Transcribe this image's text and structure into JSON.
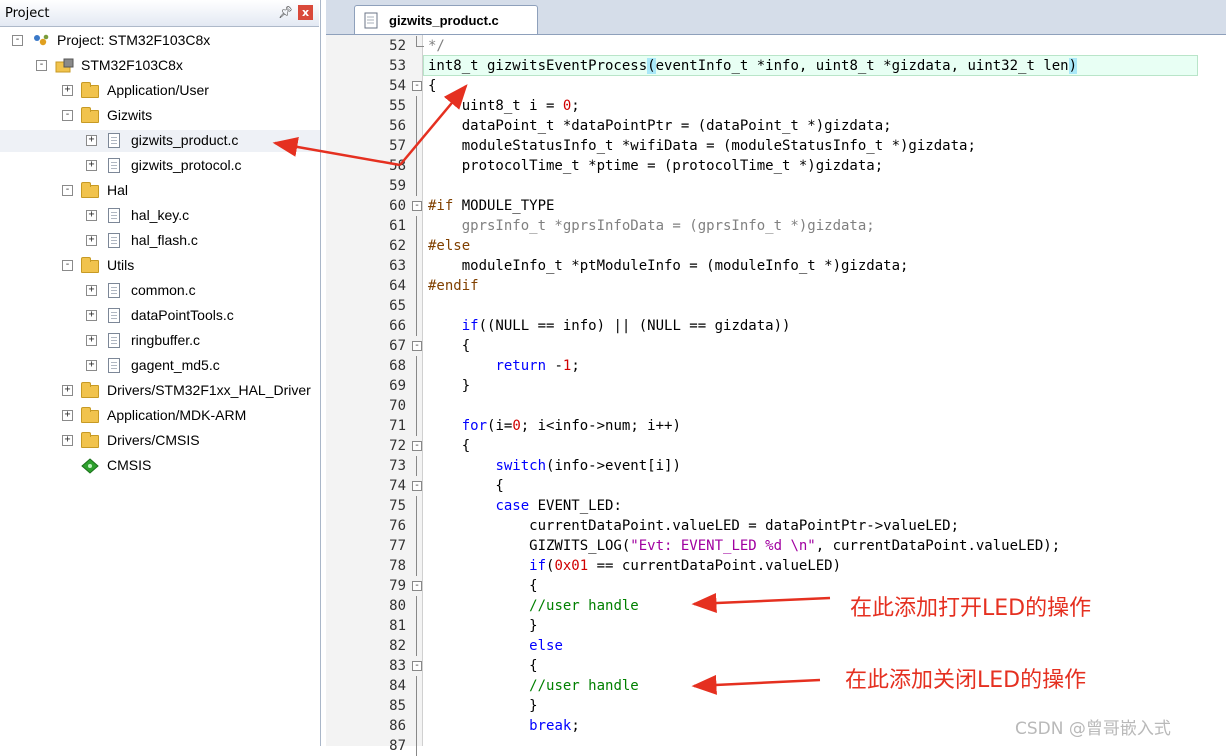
{
  "project_panel": {
    "title": "Project",
    "pin_glyph": "ᴾ",
    "close_glyph": "x",
    "tree": [
      {
        "label": "Project: STM32F103C8x",
        "icon": "project-icon",
        "indent": 0,
        "expander": "-"
      },
      {
        "label": "STM32F103C8x",
        "icon": "target-icon",
        "indent": 1,
        "expander": "-"
      },
      {
        "label": "Application/User",
        "icon": "folder-icon",
        "indent": 2,
        "expander": "+"
      },
      {
        "label": "Gizwits",
        "icon": "folder-icon",
        "indent": 2,
        "expander": "-"
      },
      {
        "label": "gizwits_product.c",
        "icon": "file-icon",
        "indent": 3,
        "expander": "+",
        "selected": true
      },
      {
        "label": "gizwits_protocol.c",
        "icon": "file-icon",
        "indent": 3,
        "expander": "+"
      },
      {
        "label": "Hal",
        "icon": "folder-icon",
        "indent": 2,
        "expander": "-"
      },
      {
        "label": "hal_key.c",
        "icon": "file-icon",
        "indent": 3,
        "expander": "+"
      },
      {
        "label": "hal_flash.c",
        "icon": "file-icon",
        "indent": 3,
        "expander": "+"
      },
      {
        "label": "Utils",
        "icon": "folder-icon",
        "indent": 2,
        "expander": "-"
      },
      {
        "label": "common.c",
        "icon": "file-icon",
        "indent": 3,
        "expander": "+"
      },
      {
        "label": "dataPointTools.c",
        "icon": "file-icon",
        "indent": 3,
        "expander": "+"
      },
      {
        "label": "ringbuffer.c",
        "icon": "file-icon",
        "indent": 3,
        "expander": "+"
      },
      {
        "label": "gagent_md5.c",
        "icon": "file-icon",
        "indent": 3,
        "expander": "+"
      },
      {
        "label": "Drivers/STM32F1xx_HAL_Driver",
        "icon": "folder-icon",
        "indent": 2,
        "expander": "+"
      },
      {
        "label": "Application/MDK-ARM",
        "icon": "folder-icon",
        "indent": 2,
        "expander": "+"
      },
      {
        "label": "Drivers/CMSIS",
        "icon": "folder-icon",
        "indent": 2,
        "expander": "+"
      },
      {
        "label": "CMSIS",
        "icon": "component-icon",
        "indent": 2,
        "expander": ""
      }
    ]
  },
  "editor": {
    "tab_label": "gizwits_product.c",
    "lines": [
      {
        "n": "52",
        "fold": "end",
        "segs": [
          [
            "pp",
            "*/"
          ]
        ]
      },
      {
        "n": "53",
        "fold": "",
        "segs": [
          [
            "",
            "int8_t gizwitsEventProcess"
          ],
          [
            "bm",
            "("
          ],
          [
            "",
            "eventInfo_t *info, uint8_t *gizdata, uint32_t len"
          ],
          [
            "bm",
            ")"
          ]
        ]
      },
      {
        "n": "54",
        "fold": "box",
        "segs": [
          [
            "",
            "{"
          ]
        ]
      },
      {
        "n": "55",
        "fold": "line",
        "segs": [
          [
            "",
            "    uint8_t i = "
          ],
          [
            "num",
            "0"
          ],
          [
            "",
            ";"
          ]
        ]
      },
      {
        "n": "56",
        "fold": "line",
        "segs": [
          [
            "",
            "    dataPoint_t *dataPointPtr = (dataPoint_t *)gizdata;"
          ]
        ]
      },
      {
        "n": "57",
        "fold": "line",
        "segs": [
          [
            "",
            "    moduleStatusInfo_t *wifiData = (moduleStatusInfo_t *)gizdata;"
          ]
        ]
      },
      {
        "n": "58",
        "fold": "line",
        "segs": [
          [
            "",
            "    protocolTime_t *ptime = (protocolTime_t *)gizdata;"
          ]
        ]
      },
      {
        "n": "59",
        "fold": "line",
        "segs": [
          [
            "",
            ""
          ]
        ]
      },
      {
        "n": "60",
        "fold": "box",
        "segs": [
          [
            "pp2",
            "#if"
          ],
          [
            "",
            " MODULE_TYPE"
          ]
        ]
      },
      {
        "n": "61",
        "fold": "line",
        "segs": [
          [
            "pp",
            "    gprsInfo_t *gprsInfoData = (gprsInfo_t *)gizdata;"
          ]
        ]
      },
      {
        "n": "62",
        "fold": "line",
        "segs": [
          [
            "pp2",
            "#else"
          ]
        ]
      },
      {
        "n": "63",
        "fold": "line",
        "segs": [
          [
            "",
            "    moduleInfo_t *ptModuleInfo = (moduleInfo_t *)gizdata;"
          ]
        ]
      },
      {
        "n": "64",
        "fold": "line",
        "segs": [
          [
            "pp2",
            "#endif"
          ]
        ]
      },
      {
        "n": "65",
        "fold": "line",
        "segs": [
          [
            "",
            ""
          ]
        ]
      },
      {
        "n": "66",
        "fold": "line",
        "segs": [
          [
            "",
            "    "
          ],
          [
            "kw",
            "if"
          ],
          [
            "",
            "((NULL == info) || (NULL == gizdata))"
          ]
        ]
      },
      {
        "n": "67",
        "fold": "box",
        "segs": [
          [
            "",
            "    {"
          ]
        ]
      },
      {
        "n": "68",
        "fold": "line",
        "segs": [
          [
            "",
            "        "
          ],
          [
            "kw",
            "return"
          ],
          [
            "",
            " -"
          ],
          [
            "num",
            "1"
          ],
          [
            "",
            ";"
          ]
        ]
      },
      {
        "n": "69",
        "fold": "line",
        "segs": [
          [
            "",
            "    }"
          ]
        ]
      },
      {
        "n": "70",
        "fold": "line",
        "segs": [
          [
            "",
            ""
          ]
        ]
      },
      {
        "n": "71",
        "fold": "line",
        "segs": [
          [
            "",
            "    "
          ],
          [
            "kw",
            "for"
          ],
          [
            "",
            "(i="
          ],
          [
            "num",
            "0"
          ],
          [
            "",
            "; i<info->num; i++)"
          ]
        ]
      },
      {
        "n": "72",
        "fold": "box",
        "segs": [
          [
            "",
            "    {"
          ]
        ]
      },
      {
        "n": "73",
        "fold": "line",
        "segs": [
          [
            "",
            "        "
          ],
          [
            "kw",
            "switch"
          ],
          [
            "",
            "(info->event[i])"
          ]
        ]
      },
      {
        "n": "74",
        "fold": "box",
        "segs": [
          [
            "",
            "        {"
          ]
        ]
      },
      {
        "n": "75",
        "fold": "line",
        "segs": [
          [
            "",
            "        "
          ],
          [
            "kw",
            "case"
          ],
          [
            "",
            " EVENT_LED:"
          ]
        ]
      },
      {
        "n": "76",
        "fold": "line",
        "segs": [
          [
            "",
            "            currentDataPoint.valueLED = dataPointPtr->valueLED;"
          ]
        ]
      },
      {
        "n": "77",
        "fold": "line",
        "segs": [
          [
            "",
            "            GIZWITS_LOG("
          ],
          [
            "str",
            "\"Evt: EVENT_LED %d \\n\""
          ],
          [
            "",
            ", currentDataPoint.valueLED);"
          ]
        ]
      },
      {
        "n": "78",
        "fold": "line",
        "segs": [
          [
            "",
            "            "
          ],
          [
            "kw",
            "if"
          ],
          [
            "",
            "("
          ],
          [
            "num",
            "0x01"
          ],
          [
            "",
            " == currentDataPoint.valueLED)"
          ]
        ]
      },
      {
        "n": "79",
        "fold": "box",
        "segs": [
          [
            "",
            "            {"
          ]
        ]
      },
      {
        "n": "80",
        "fold": "line",
        "segs": [
          [
            "",
            "            "
          ],
          [
            "cm",
            "//user handle"
          ]
        ]
      },
      {
        "n": "81",
        "fold": "line",
        "segs": [
          [
            "",
            "            }"
          ]
        ]
      },
      {
        "n": "82",
        "fold": "line",
        "segs": [
          [
            "",
            "            "
          ],
          [
            "kw",
            "else"
          ]
        ]
      },
      {
        "n": "83",
        "fold": "box",
        "segs": [
          [
            "",
            "            {"
          ]
        ]
      },
      {
        "n": "84",
        "fold": "line",
        "segs": [
          [
            "",
            "            "
          ],
          [
            "cm",
            "//user handle"
          ]
        ]
      },
      {
        "n": "85",
        "fold": "line",
        "segs": [
          [
            "",
            "            }"
          ]
        ]
      },
      {
        "n": "86",
        "fold": "line",
        "segs": [
          [
            "",
            "            "
          ],
          [
            "kw",
            "break"
          ],
          [
            "",
            ";"
          ]
        ]
      },
      {
        "n": "87",
        "fold": "line",
        "segs": [
          [
            "",
            ""
          ]
        ]
      }
    ]
  },
  "annotations": {
    "open_led": "在此添加打开LED的操作",
    "close_led": "在此添加关闭LED的操作"
  },
  "watermark": "CSDN @曾哥嵌入式",
  "colors": {
    "annotation": "#e53020",
    "keyword": "#0000ff",
    "comment": "#008000"
  }
}
